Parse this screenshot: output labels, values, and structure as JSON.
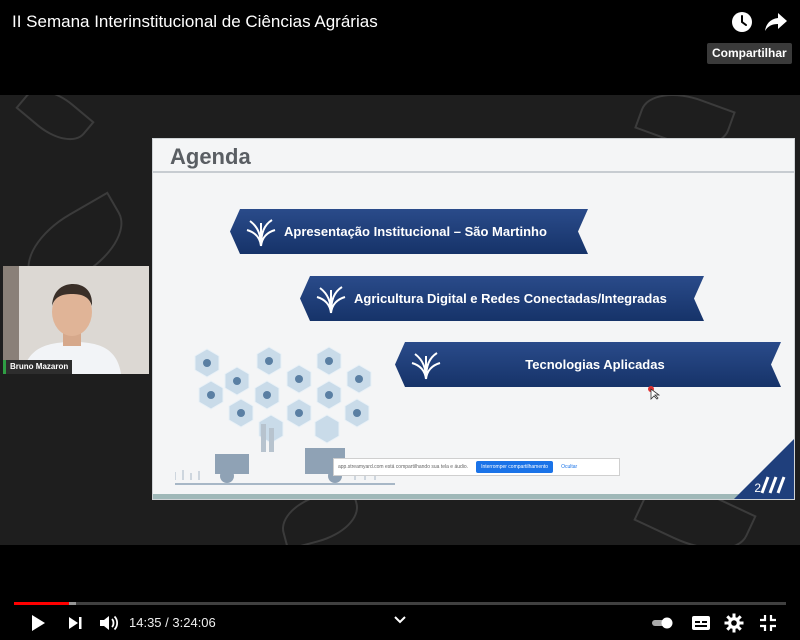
{
  "header": {
    "title": "II Semana Interinstitucional de Ciências Agrárias",
    "watch_later_icon": "clock-icon",
    "share_icon": "share-arrow-icon",
    "tooltip": "Compartilhar"
  },
  "slide": {
    "title": "Agenda",
    "items": [
      {
        "label": "Apresentação Institucional – São Martinho"
      },
      {
        "label": "Agricultura Digital e Redes Conectadas/Integradas"
      },
      {
        "label": "Tecnologias Aplicadas"
      }
    ],
    "page_number": "2",
    "share_bar": {
      "message": "app.streamyard.com está compartilhando sua tela e áudio.",
      "stop_label": "Interromper compartilhamento",
      "hide_label": "Ocultar"
    }
  },
  "presenter": {
    "name": "Bruno Mazaron"
  },
  "player": {
    "current_time": "14:35",
    "separator": " / ",
    "duration": "3:24:06",
    "progress_fraction": 0.0714,
    "accent": "#ff0000"
  },
  "colors": {
    "banner": "#1f3f7c",
    "slide_bg": "#f4f5f6"
  }
}
